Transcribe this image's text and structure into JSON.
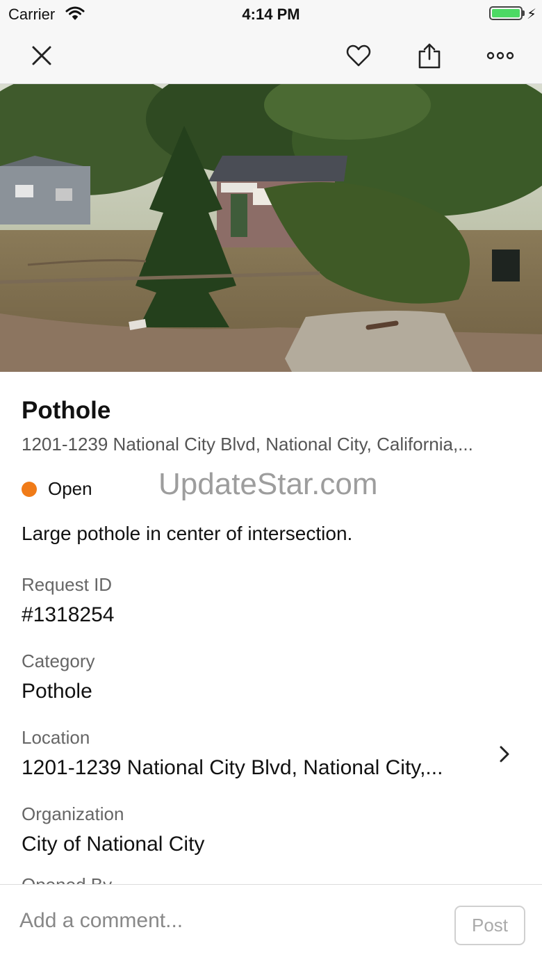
{
  "status_bar": {
    "carrier": "Carrier",
    "time": "4:14 PM",
    "battery_color": "#4cd964"
  },
  "nav": {
    "icons": [
      "close-icon",
      "heart-icon",
      "share-icon",
      "more-icon"
    ]
  },
  "report": {
    "title": "Pothole",
    "address": "1201-1239 National City Blvd, National City, California,...",
    "status": "Open",
    "status_color": "#f07b18",
    "description": "Large pothole in center of intersection."
  },
  "watermark": "UpdateStar.com",
  "details": {
    "request_id": {
      "label": "Request ID",
      "value": "#1318254"
    },
    "category": {
      "label": "Category",
      "value": "Pothole"
    },
    "location": {
      "label": "Location",
      "value": "1201-1239 National City Blvd, National City,..."
    },
    "organization": {
      "label": "Organization",
      "value": "City of National City"
    },
    "next_label": "Opened By"
  },
  "comment": {
    "placeholder": "Add a comment...",
    "post_label": "Post"
  }
}
